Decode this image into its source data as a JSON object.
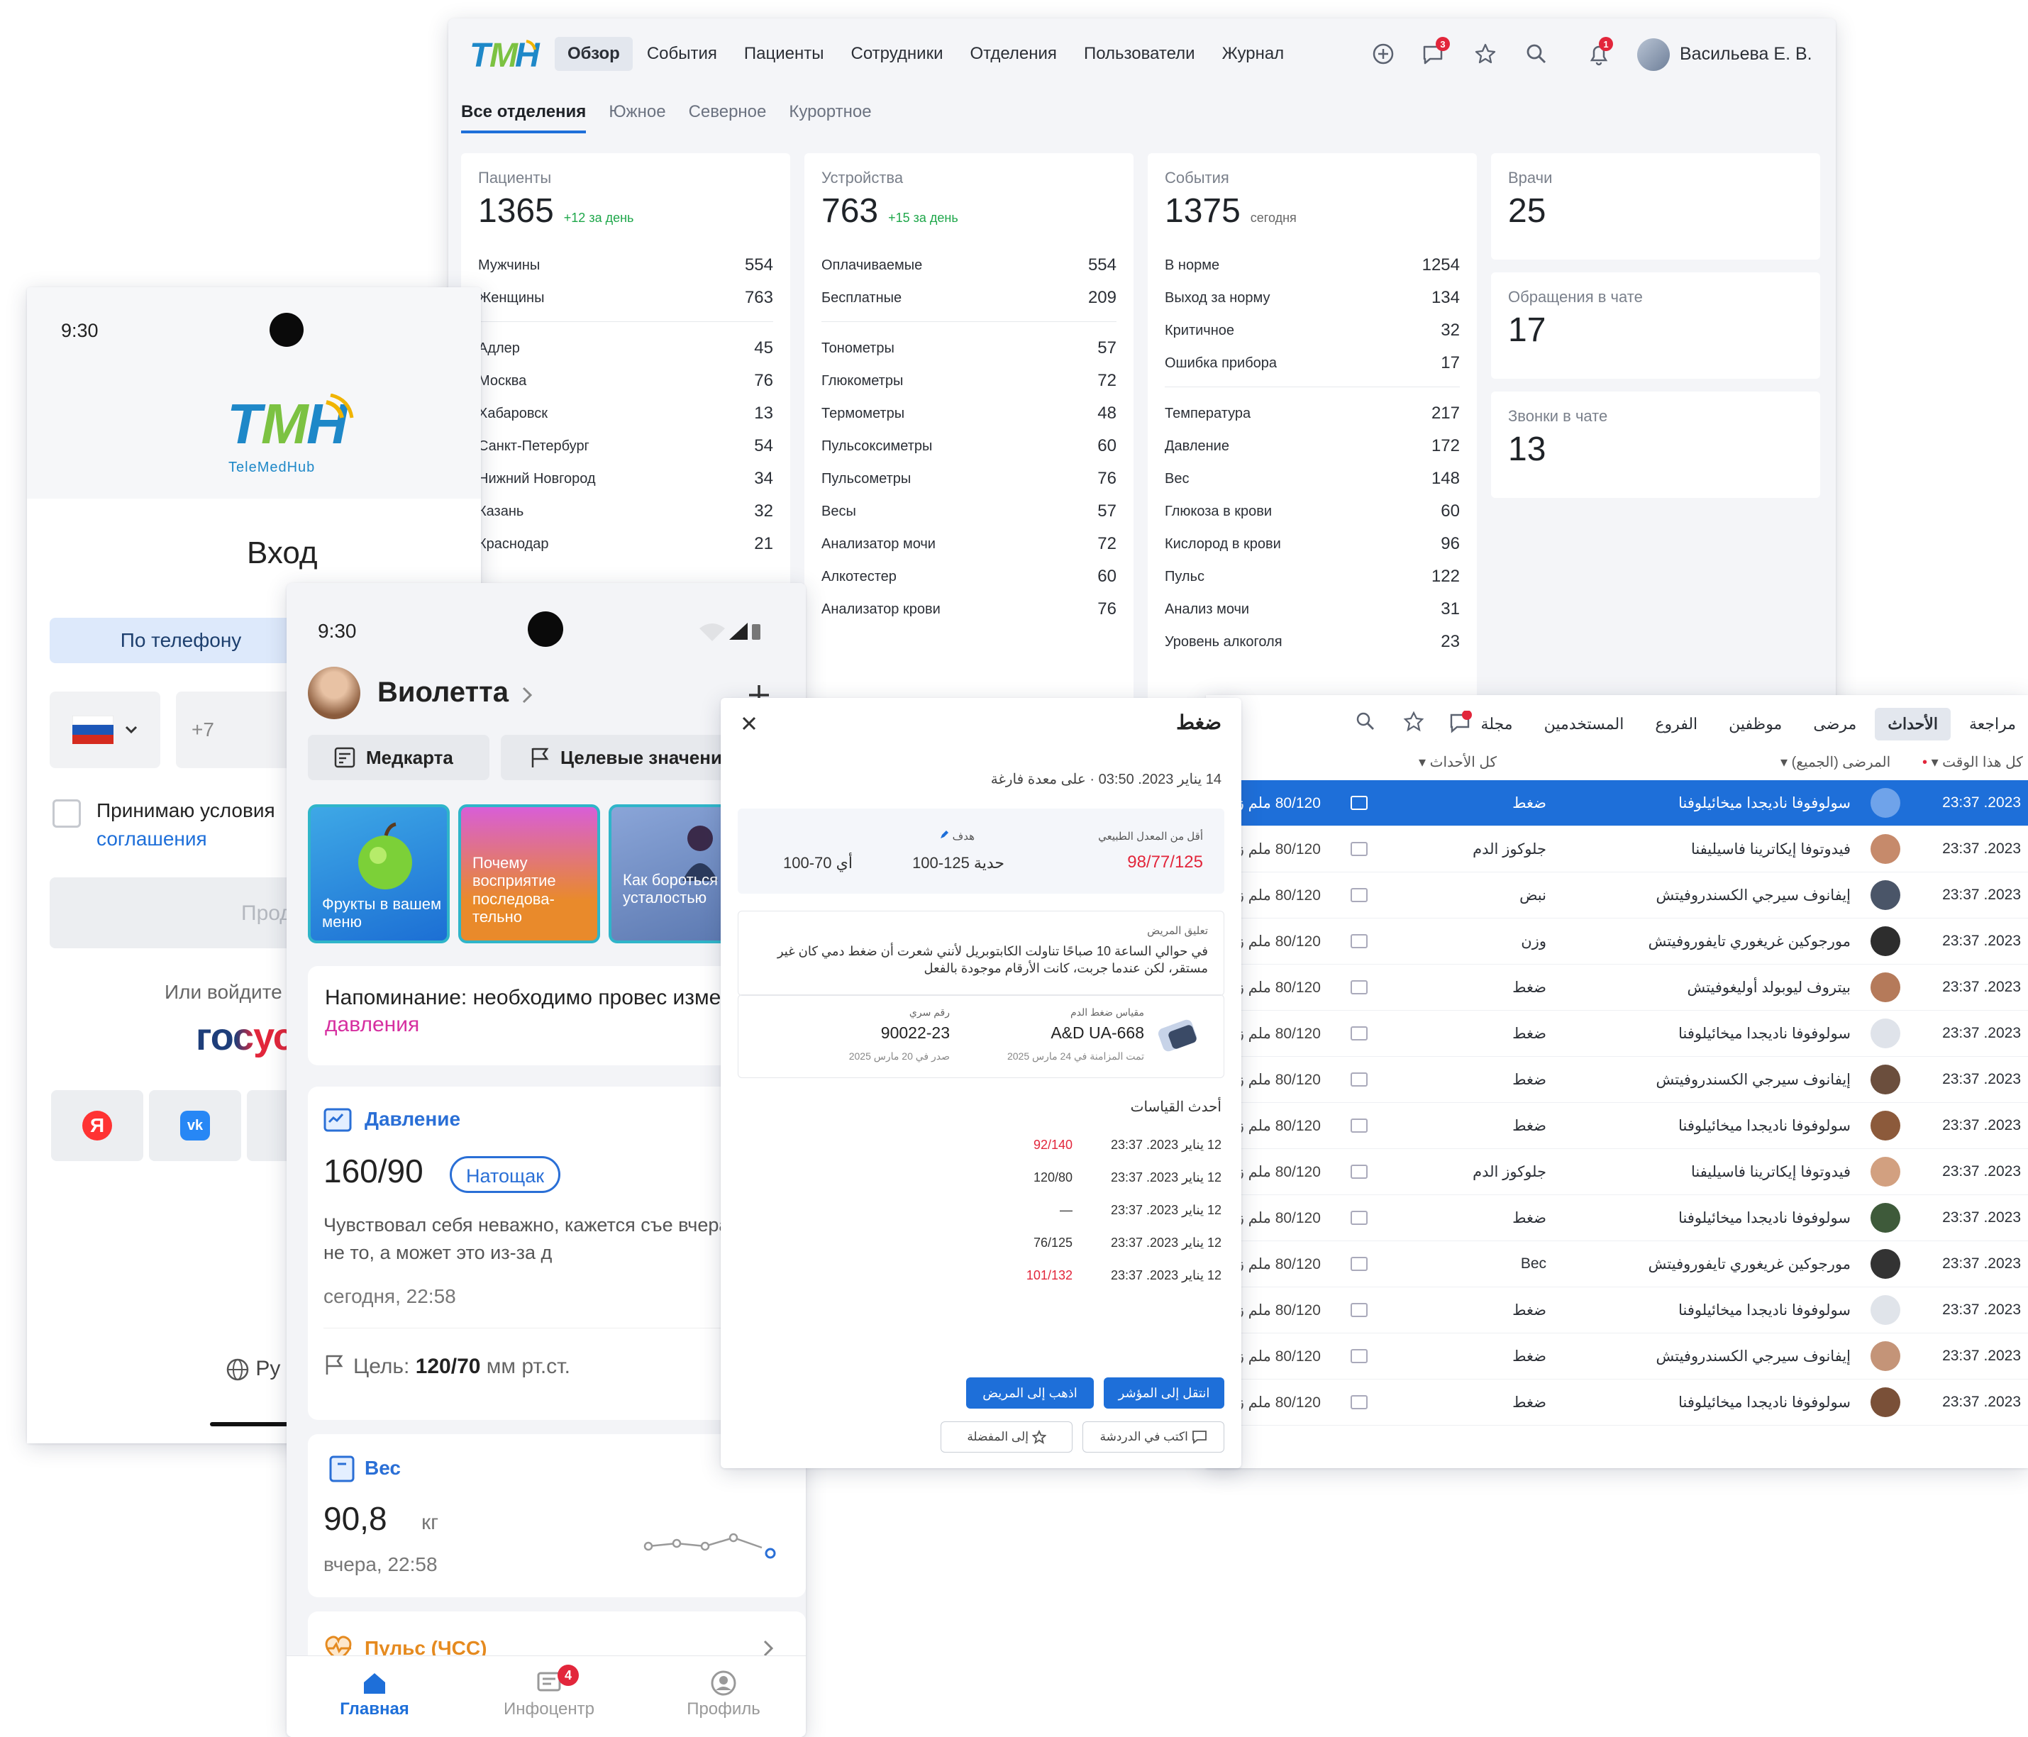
{
  "dashboard": {
    "logo": "TMH",
    "nav": [
      "Обзор",
      "События",
      "Пациенты",
      "Сотрудники",
      "Отделения",
      "Пользователи",
      "Журнал"
    ],
    "chat_badge": "3",
    "bell_badge": "1",
    "user_name": "Васильева Е. В.",
    "subtabs": [
      "Все отделения",
      "Южное",
      "Северное",
      "Курортное"
    ],
    "patients": {
      "title": "Пациенты",
      "value": "1365",
      "delta": "+12 за день",
      "rows1": [
        {
          "label": "Мужчины",
          "value": "554"
        },
        {
          "label": "Женщины",
          "value": "763"
        }
      ],
      "rows2": [
        {
          "label": "Адлер",
          "value": "45"
        },
        {
          "label": "Москва",
          "value": "76"
        },
        {
          "label": "Хабаровск",
          "value": "13"
        },
        {
          "label": "Санкт-Петербург",
          "value": "54"
        },
        {
          "label": "Нижний Новгород",
          "value": "34"
        },
        {
          "label": "Казань",
          "value": "32"
        },
        {
          "label": "Краснодар",
          "value": "21"
        }
      ]
    },
    "devices": {
      "title": "Устройства",
      "value": "763",
      "delta": "+15 за день",
      "rows1": [
        {
          "label": "Оплачиваемые",
          "value": "554"
        },
        {
          "label": "Бесплатные",
          "value": "209"
        }
      ],
      "rows2": [
        {
          "label": "Тонометры",
          "value": "57"
        },
        {
          "label": "Глюкометры",
          "value": "72"
        },
        {
          "label": "Термометры",
          "value": "48"
        },
        {
          "label": "Пульсоксиметры",
          "value": "60"
        },
        {
          "label": "Пульсометры",
          "value": "76"
        },
        {
          "label": "Весы",
          "value": "57"
        },
        {
          "label": "Анализатор мочи",
          "value": "72"
        },
        {
          "label": "Алкотестер",
          "value": "60"
        },
        {
          "label": "Анализатор крови",
          "value": "76"
        }
      ]
    },
    "events": {
      "title": "События",
      "value": "1375",
      "delta": "сегодня",
      "rows1": [
        {
          "label": "В норме",
          "value": "1254"
        },
        {
          "label": "Выход за норму",
          "value": "134"
        },
        {
          "label": "Критичное",
          "value": "32"
        },
        {
          "label": "Ошибка прибора",
          "value": "17"
        }
      ],
      "rows2": [
        {
          "label": "Температура",
          "value": "217"
        },
        {
          "label": "Давление",
          "value": "172"
        },
        {
          "label": "Вес",
          "value": "148"
        },
        {
          "label": "Глюкоза в крови",
          "value": "60"
        },
        {
          "label": "Кислород в крови",
          "value": "96"
        },
        {
          "label": "Пульс",
          "value": "122"
        },
        {
          "label": "Анализ мочи",
          "value": "31"
        },
        {
          "label": "Уровень алкоголя",
          "value": "23"
        }
      ]
    },
    "doctors": {
      "title": "Врачи",
      "value": "25"
    },
    "chat_requests": {
      "title": "Обращения в чате",
      "value": "17"
    },
    "chat_calls": {
      "title": "Звонки в чате",
      "value": "13"
    }
  },
  "login": {
    "time": "9:30",
    "logo": "TMH",
    "logo_sub": "TeleMedHub",
    "title": "Вход",
    "tab_phone": "По телефону",
    "phone_prefix": "+7",
    "agree_text": "Принимаю условия",
    "agree_link": "соглашения",
    "continue": "Продо",
    "or_login": "Или войдите",
    "gosuslugi": "госус",
    "lang": "Ру"
  },
  "patient": {
    "time": "9:30",
    "name": "Виолетта",
    "medcard": "Медкарта",
    "targets": "Целевые значени",
    "stories": [
      "Фрукты в вашем меню",
      "Почему восприятие последова-тельно",
      "Как бороться с усталостью"
    ],
    "reminder_text": "Напоминание: необходимо провес измерение ",
    "reminder_link": "давления",
    "pressure": {
      "title": "Давление",
      "value": "160/90",
      "tag": "Натощак",
      "note": "Чувствовал себя неважно, кажется съе вчера что-то не то, а может это из-за д",
      "time": "сегодня, 22:58",
      "goal_label": "Цель: ",
      "goal_value": "120/70",
      "goal_unit": " мм рт.ст."
    },
    "weight": {
      "title": "Вес",
      "value": "90,8",
      "unit": "кг",
      "time": "вчера, 22:58"
    },
    "pulse": {
      "title": "Пульс (ЧСС)"
    },
    "tabbar": [
      {
        "label": "Главная"
      },
      {
        "label": "Инфоцентр",
        "badge": "4"
      },
      {
        "label": "Профиль"
      }
    ]
  },
  "modal": {
    "title": "ضغط",
    "meta": "14 يناير 2023. 03:50 · على معدة فارغة",
    "target_label": "هدف",
    "target_value": "100-125 حدية",
    "target_value2": "أي 70-100",
    "norm_label": "أقل من المعدل الطبيعي",
    "norm_value": "98/77/125",
    "comment_label": "تعليق المريض",
    "comment": "في حوالي الساعة 10 صباحًا تناولت الكابتوبريل لأنني شعرت أن ضغط دمي كان غير مستقر، لكن عندما جربت، كانت الأرقام موجودة بالفعل",
    "device_label": "مقياس ضغط الدم",
    "device_name": "A&D UA-668",
    "device_date": "تمت المزامنة في 24 مارس 2025",
    "serial_label": "رقم سري",
    "serial": "90022-23",
    "serial_date": "صدر في 20 مارس 2025",
    "latest_title": "أحدث القياسات",
    "latest": [
      {
        "date": "12 يناير 2023. 23:37",
        "value": "92/140",
        "alert": true
      },
      {
        "date": "12 يناير 2023. 23:37",
        "value": "120/80",
        "alert": false
      },
      {
        "date": "12 يناير 2023. 23:37",
        "value": "—",
        "alert": false
      },
      {
        "date": "12 يناير 2023. 23:37",
        "value": "76/125",
        "alert": false
      },
      {
        "date": "12 يناير 2023. 23:37",
        "value": "101/132",
        "alert": true
      }
    ],
    "btn_patient": "اذهب إلى المريض",
    "btn_indicator": "انتقل إلى المؤشر",
    "btn_fav": "إلى المفضلة",
    "btn_chat": "اكتب في الدردشة"
  },
  "artable": {
    "nav": [
      "مراجعة",
      "الأحداث",
      "مرضى",
      "موظفين",
      "الفروع",
      "المستخدمين",
      "مجلة"
    ],
    "filter_all_time": "كل هذا الوقت",
    "filter_patient": "المرضى (الجميع)",
    "filter_events": "كل الأحداث",
    "rows": [
      {
        "date": "23:37 .2023",
        "name": "سولوفوفا ناديجدا ميخائيلوفنا",
        "type": "ضغط",
        "value": "80/120 ملم زئبق",
        "selected": true
      },
      {
        "date": "23:37 .2023",
        "name": "فيدوتوفا إيكاترينا فاسيليفنا",
        "type": "جلوكوز الدم",
        "value": "80/120 ملم زئبق",
        "selected": false
      },
      {
        "date": "23:37 .2023",
        "name": "إيفانوف سيرجي الكسندروفيتش",
        "type": "نبض",
        "value": "80/120 ملم زئبق",
        "selected": false
      },
      {
        "date": "23:37 .2023",
        "name": "مورجوكين غريغوري تايفوروفيتش",
        "type": "وزن",
        "value": "80/120 ملم زئبق",
        "selected": false
      },
      {
        "date": "23:37 .2023",
        "name": "بيتروف ليوبولد أوليغوفيتش",
        "type": "ضغط",
        "value": "80/120 ملم زئبق",
        "selected": false
      },
      {
        "date": "23:37 .2023",
        "name": "سولوفوفا ناديجدا ميخائيلوفنا",
        "type": "ضغط",
        "value": "80/120 ملم زئبق",
        "selected": false
      },
      {
        "date": "23:37 .2023",
        "name": "إيفانوف سيرجي الكسندروفيتش",
        "type": "ضغط",
        "value": "80/120 ملم زئبق",
        "selected": false
      },
      {
        "date": "23:37 .2023",
        "name": "سولوفوفا ناديجدا ميخائيلوفنا",
        "type": "ضغط",
        "value": "80/120 ملم زئبق",
        "selected": false
      },
      {
        "date": "23:37 .2023",
        "name": "فيدوتوفا إيكاترينا فاسيليفنا",
        "type": "جلوكوز الدم",
        "value": "80/120 ملم زئبق",
        "selected": false
      },
      {
        "date": "23:37 .2023",
        "name": "سولوفوفا ناديجدا ميخائيلوفنا",
        "type": "ضغط",
        "value": "80/120 ملم زئبق",
        "selected": false
      },
      {
        "date": "23:37 .2023",
        "name": "مورجوكين غريغوري تايفوروفيتش",
        "type": "Вес",
        "value": "80/120 ملم زئبق",
        "selected": false
      },
      {
        "date": "23:37 .2023",
        "name": "سولوفوفا ناديجدا ميخائيلوفنا",
        "type": "ضغط",
        "value": "80/120 ملم زئبق",
        "selected": false
      },
      {
        "date": "23:37 .2023",
        "name": "إيفانوف سيرجي الكسندروفيتش",
        "type": "ضغط",
        "value": "80/120 ملم زئبق",
        "selected": false
      },
      {
        "date": "23:37 .2023",
        "name": "سولوفوفا ناديجدا ميخائيلوفنا",
        "type": "ضغط",
        "value": "80/120 ملم زئبق",
        "selected": false
      }
    ]
  },
  "colors": {
    "accent": "#1e6fd9",
    "green": "#1ea74a",
    "alert": "#e2263b",
    "pressure_tag": "#2a6fd6"
  }
}
